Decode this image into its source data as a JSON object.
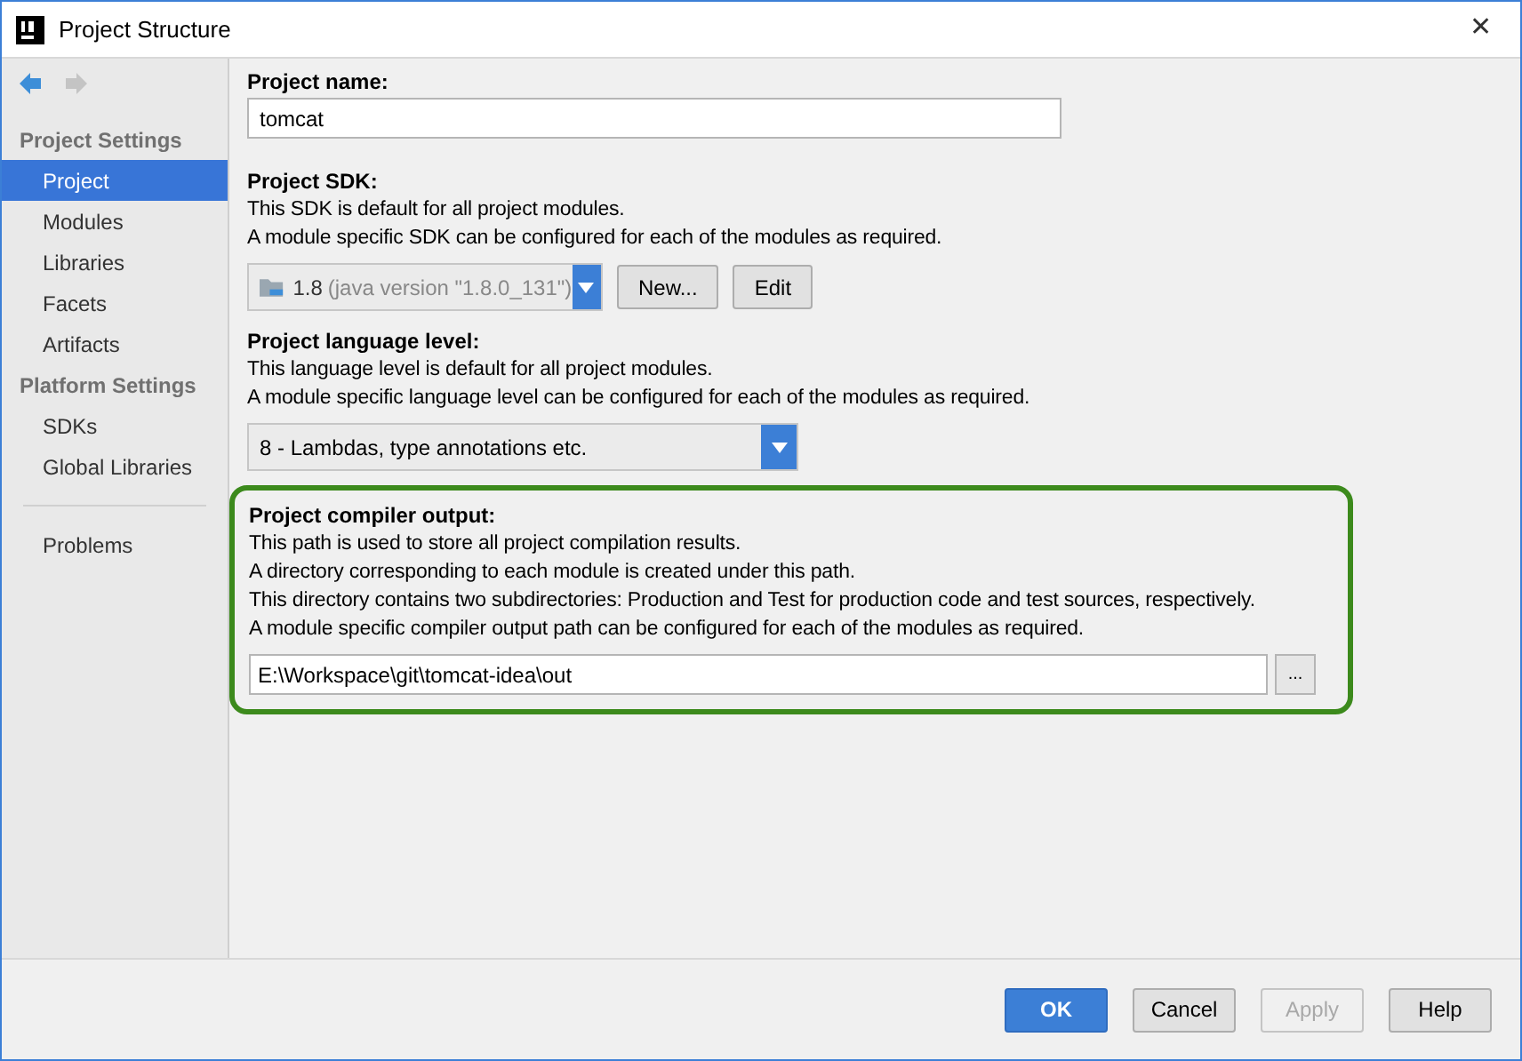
{
  "window": {
    "title": "Project Structure",
    "close": "✕"
  },
  "nav": {
    "back_enabled": true,
    "forward_enabled": false
  },
  "sidebar": {
    "sections": [
      {
        "title": "Project Settings",
        "items": [
          {
            "label": "Project",
            "selected": true
          },
          {
            "label": "Modules",
            "selected": false
          },
          {
            "label": "Libraries",
            "selected": false
          },
          {
            "label": "Facets",
            "selected": false
          },
          {
            "label": "Artifacts",
            "selected": false
          }
        ]
      },
      {
        "title": "Platform Settings",
        "items": [
          {
            "label": "SDKs",
            "selected": false
          },
          {
            "label": "Global Libraries",
            "selected": false
          }
        ]
      }
    ],
    "extra_items": [
      {
        "label": "Problems",
        "selected": false
      }
    ]
  },
  "project_name": {
    "label": "Project name:",
    "value": "tomcat"
  },
  "sdk": {
    "label": "Project SDK:",
    "lines": [
      "This SDK is default for all project modules.",
      "A module specific SDK can be configured for each of the modules as required."
    ],
    "version": "1.8",
    "detail": "(java version \"1.8.0_131\")",
    "buttons": [
      "New...",
      "Edit"
    ]
  },
  "language_level": {
    "label": "Project language level:",
    "lines": [
      "This language level is default for all project modules.",
      "A module specific language level can be configured for each of the modules as required."
    ],
    "value": "8 - Lambdas, type annotations etc."
  },
  "compiler_output": {
    "highlighted": true,
    "label": "Project compiler output:",
    "lines": [
      "This path is used to store all project compilation results.",
      "A directory corresponding to each module is created under this path.",
      "This directory contains two subdirectories: Production and Test for production code and test sources, respectively.",
      "A module specific compiler output path can be configured for each of the modules as required."
    ],
    "value": "E:\\Workspace\\git\\tomcat-idea\\out",
    "browse": "..."
  },
  "buttons": [
    {
      "label": "OK",
      "kind": "primary",
      "disabled": false
    },
    {
      "label": "Cancel",
      "kind": "normal",
      "disabled": false
    },
    {
      "label": "Apply",
      "kind": "normal",
      "disabled": true
    },
    {
      "label": "Help",
      "kind": "normal",
      "disabled": false
    }
  ]
}
